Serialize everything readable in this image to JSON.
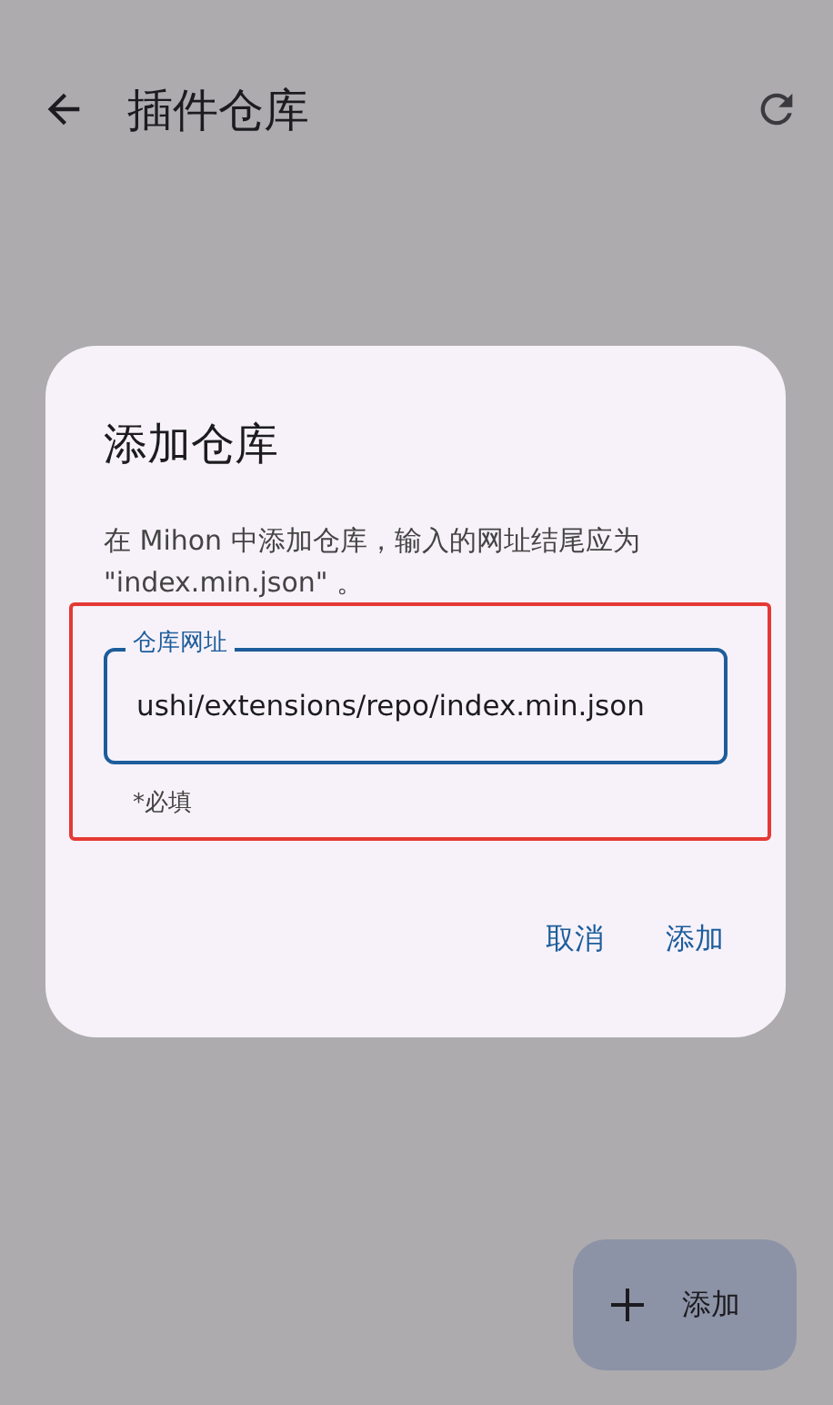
{
  "app_bar": {
    "title": "插件仓库"
  },
  "dialog": {
    "title": "添加仓库",
    "message": "在 Mihon 中添加仓库，输入的网址结尾应为 \"index.min.json\" 。",
    "field": {
      "label": "仓库网址",
      "value": "ushi/extensions/repo/index.min.json",
      "focused": true,
      "helper": "*必填"
    },
    "buttons": [
      "取消",
      "添加"
    ]
  },
  "fab": {
    "label": "添加"
  }
}
